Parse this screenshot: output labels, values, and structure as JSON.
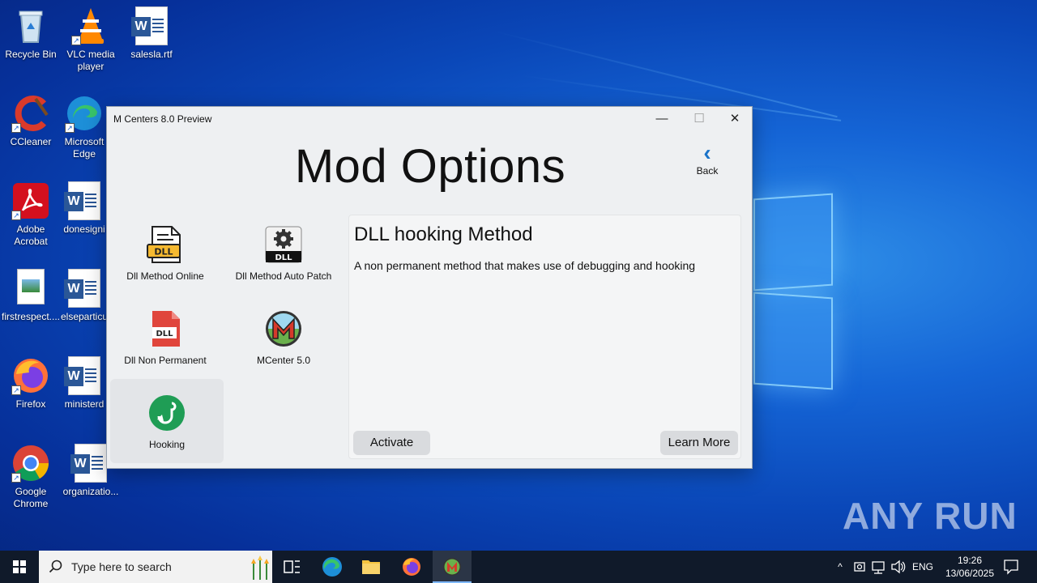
{
  "desktop": {
    "icons": [
      {
        "label": "Recycle Bin",
        "icon": "recycle-bin-icon"
      },
      {
        "label": "VLC media player",
        "icon": "vlc-icon"
      },
      {
        "label": "salesla.rtf",
        "icon": "word-doc-icon"
      },
      {
        "label": "CCleaner",
        "icon": "ccleaner-icon"
      },
      {
        "label": "Microsoft Edge",
        "icon": "edge-icon"
      },
      {
        "label": "Adobe Acrobat",
        "icon": "acrobat-icon"
      },
      {
        "label": "donesigni",
        "icon": "word-doc-icon"
      },
      {
        "label": "firstrespect....",
        "icon": "image-file-icon"
      },
      {
        "label": "elseparticu",
        "icon": "word-doc-icon"
      },
      {
        "label": "Firefox",
        "icon": "firefox-icon"
      },
      {
        "label": "ministerd",
        "icon": "word-doc-icon"
      },
      {
        "label": "Google Chrome",
        "icon": "chrome-icon"
      },
      {
        "label": "organizatio...",
        "icon": "word-doc-icon"
      }
    ]
  },
  "window": {
    "title": "M Centers 8.0 Preview",
    "heading": "Mod Options",
    "back_label": "Back",
    "controls": {
      "minimize": "—",
      "maximize": "☐",
      "close": "✕"
    },
    "options": [
      {
        "label": "Dll Method Online",
        "icon": "dll-document-icon"
      },
      {
        "label": "Dll Method Auto Patch",
        "icon": "dll-gear-icon"
      },
      {
        "label": "Dll Non Permanent",
        "icon": "dll-red-document-icon"
      },
      {
        "label": "MCenter 5.0",
        "icon": "mcenter-logo-icon"
      },
      {
        "label": "Hooking",
        "icon": "hook-icon",
        "selected": true
      }
    ],
    "detail": {
      "title": "DLL hooking Method",
      "description": "A non permanent method that makes use of debugging and hooking",
      "activate_label": "Activate",
      "learn_more_label": "Learn More"
    }
  },
  "taskbar": {
    "search_placeholder": "Type here to search",
    "language": "ENG",
    "time": "19:26",
    "date": "13/06/2025"
  },
  "watermark": "ANY RUN"
}
